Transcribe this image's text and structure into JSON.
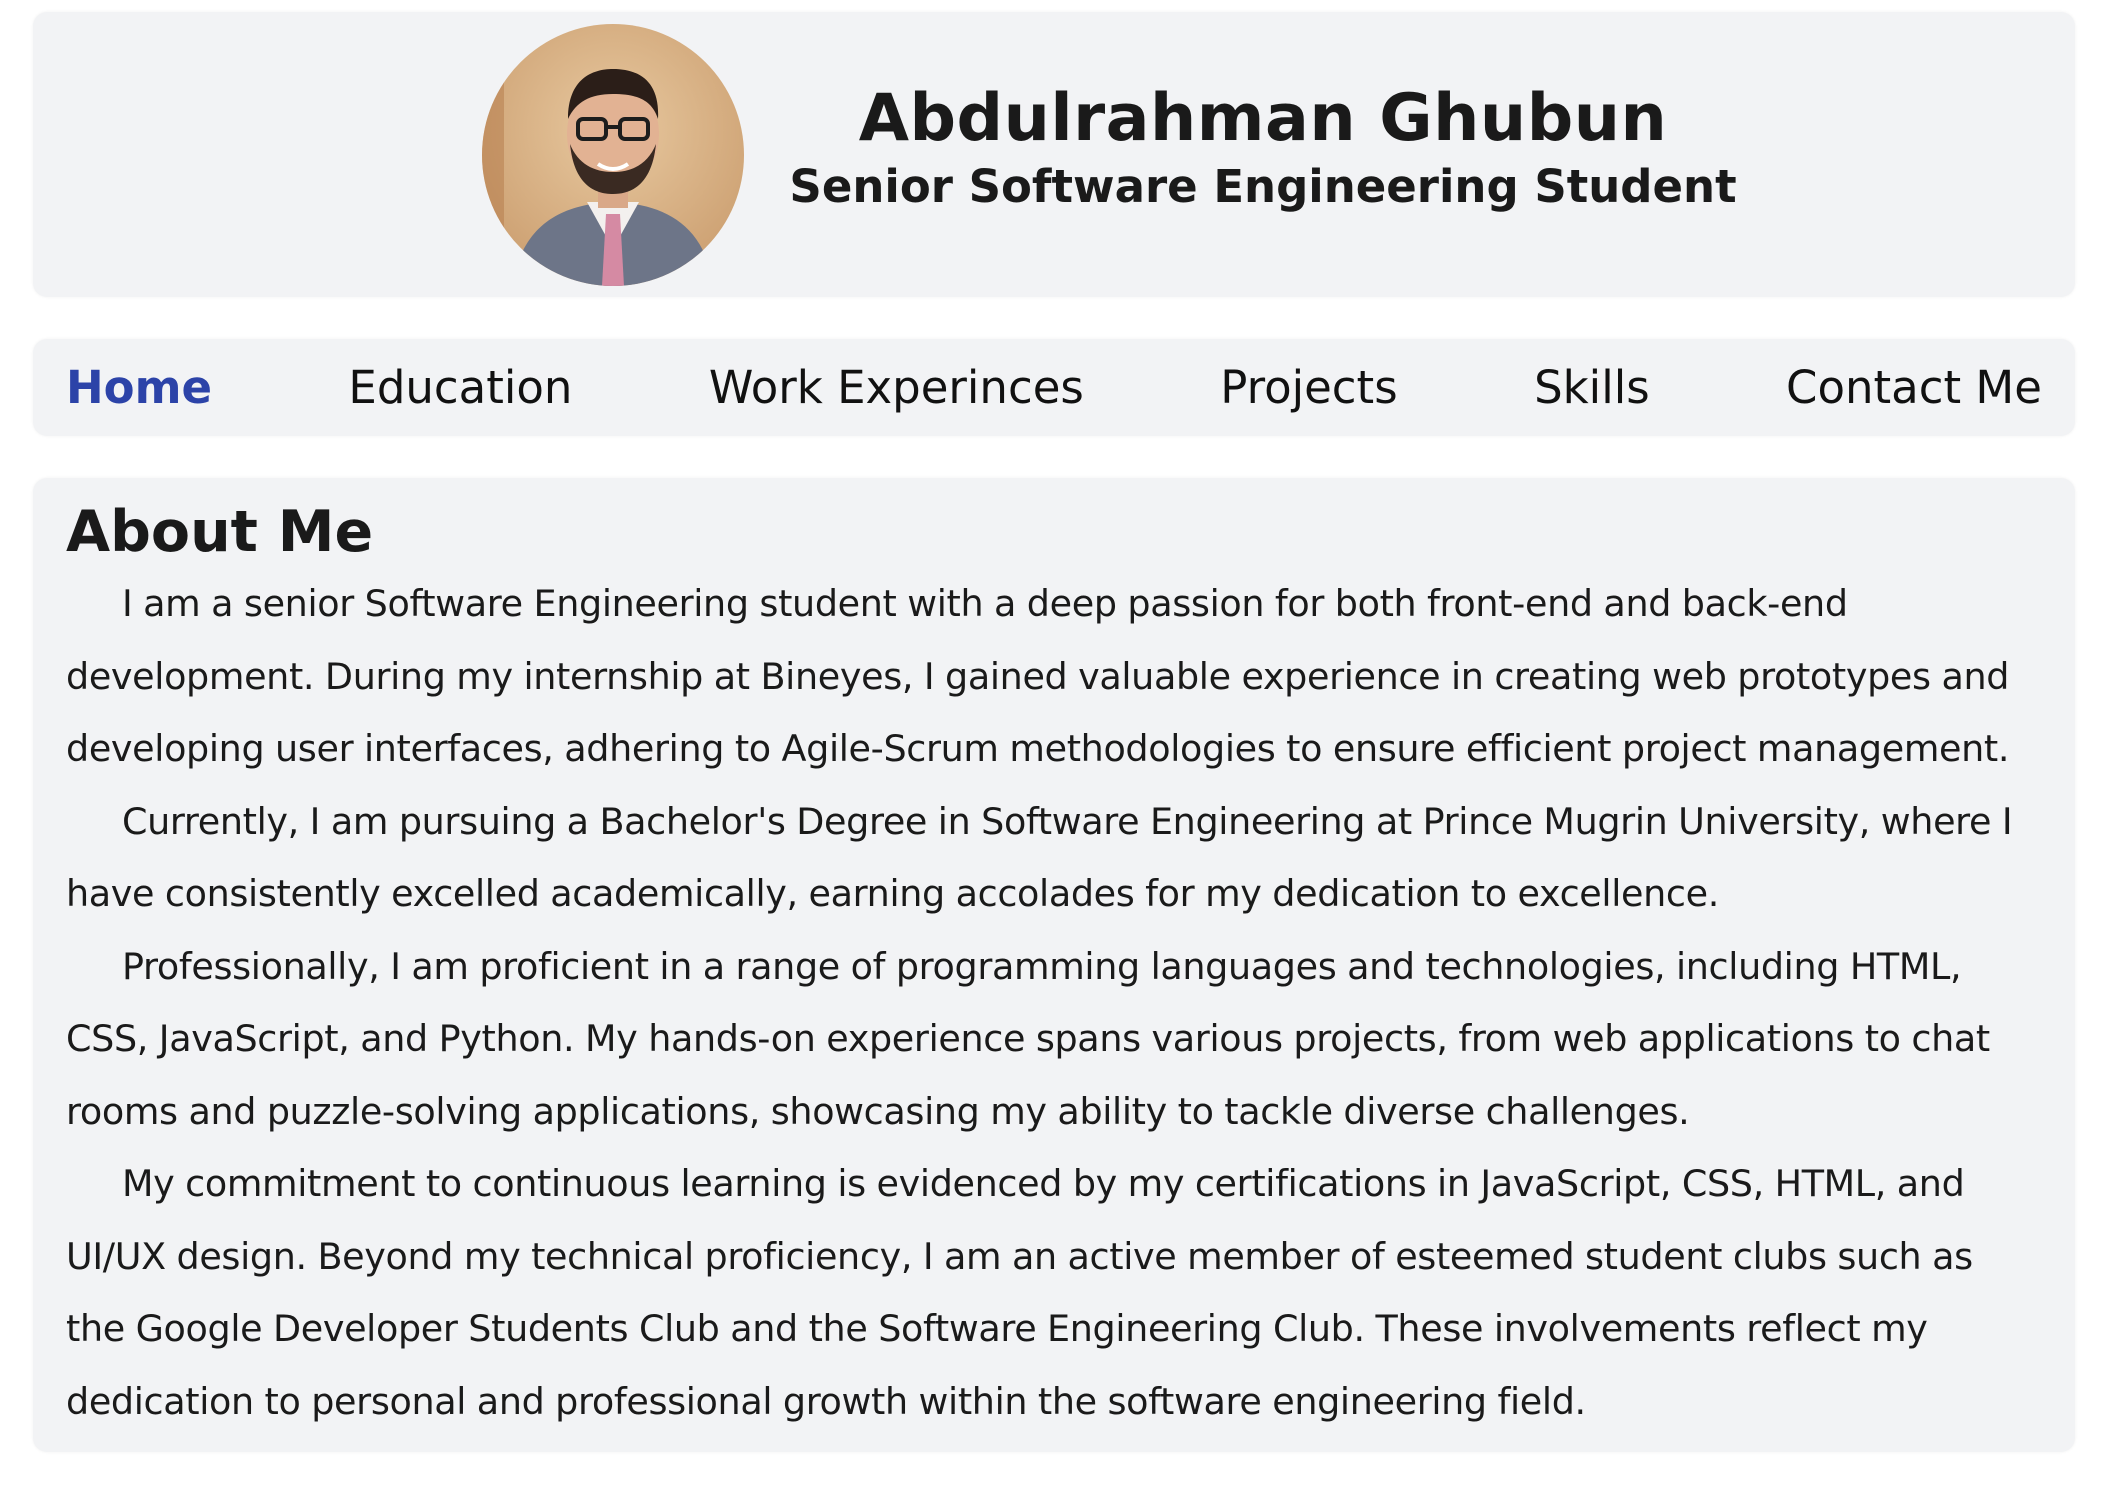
{
  "header": {
    "name": "Abdulrahman Ghubun",
    "subtitle": "Senior Software Engineering Student",
    "avatar_icon": "profile-photo"
  },
  "nav": {
    "items": [
      {
        "label": "Home",
        "active": true
      },
      {
        "label": "Education",
        "active": false
      },
      {
        "label": "Work Experinces",
        "active": false
      },
      {
        "label": "Projects",
        "active": false
      },
      {
        "label": "Skills",
        "active": false
      },
      {
        "label": "Contact Me",
        "active": false
      }
    ]
  },
  "about": {
    "title": "About Me",
    "paragraphs": [
      "I am a senior Software Engineering student with a deep passion for both front-end and back-end development. During my internship at Bineyes, I gained valuable experience in creating web prototypes and developing user interfaces, adhering to Agile-Scrum methodologies to ensure efficient project management.",
      "Currently, I am pursuing a Bachelor's Degree in Software Engineering at Prince Mugrin University, where I have consistently excelled academically, earning accolades for my dedication to excellence.",
      "Professionally, I am proficient in a range of programming languages and technologies, including HTML, CSS, JavaScript, and Python. My hands-on experience spans various projects, from web applications to chat rooms and puzzle-solving applications, showcasing my ability to tackle diverse challenges.",
      "My commitment to continuous learning is evidenced by my certifications in JavaScript, CSS, HTML, and UI/UX design. Beyond my technical proficiency, I am an active member of esteemed student clubs such as the Google Developer Students Club and the Software Engineering Club. These involvements reflect my dedication to personal and professional growth within the software engineering field."
    ]
  },
  "colors": {
    "card_background": "#f2f3f5",
    "active_nav": "#2c43a8",
    "text": "#1a1a1a"
  }
}
